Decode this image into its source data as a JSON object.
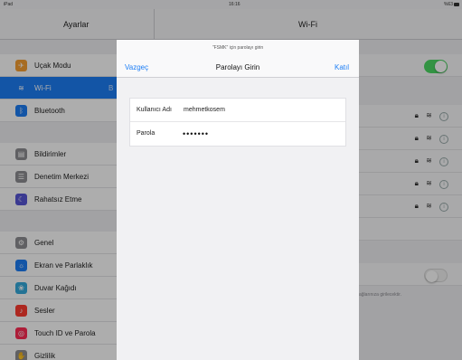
{
  "status_bar": {
    "device": "iPad",
    "time": "16:16",
    "battery": "%63"
  },
  "left_nav": {
    "title": "Ayarlar"
  },
  "right_nav": {
    "title": "Wi-Fi"
  },
  "sidebar": {
    "items": [
      {
        "label": "Uçak Modu",
        "icon": "airplane-icon",
        "color": "#f7a033"
      },
      {
        "label": "Wi-Fi",
        "sub": "B",
        "icon": "wifi-icon",
        "color": "#1d7ef5",
        "active": true
      },
      {
        "label": "Bluetooth",
        "icon": "bluetooth-icon",
        "color": "#1d7ef5"
      },
      {
        "label": "Bildirimler",
        "icon": "notifications-icon",
        "color": "#8e8e93"
      },
      {
        "label": "Denetim Merkezi",
        "icon": "control-center-icon",
        "color": "#8e8e93"
      },
      {
        "label": "Rahatsız Etme",
        "icon": "moon-icon",
        "color": "#5856d6"
      },
      {
        "label": "Genel",
        "icon": "gear-icon",
        "color": "#8e8e93"
      },
      {
        "label": "Ekran ve Parlaklık",
        "icon": "brightness-icon",
        "color": "#1d7ef5"
      },
      {
        "label": "Duvar Kağıdı",
        "icon": "wallpaper-icon",
        "color": "#34aadc"
      },
      {
        "label": "Sesler",
        "icon": "speaker-icon",
        "color": "#ff3b30"
      },
      {
        "label": "Touch ID ve Parola",
        "icon": "fingerprint-icon",
        "color": "#ff2d55"
      },
      {
        "label": "Gizlilik",
        "icon": "hand-icon",
        "color": "#8e8e93"
      }
    ]
  },
  "wifi_detail": {
    "toggle_on": true,
    "ask_toggle_on": false,
    "footnote": "ağlarınıza girilecektir."
  },
  "modal": {
    "prompt": "\"FSMK\" için parolayı girin",
    "cancel": "Vazgeç",
    "title": "Parolayı Girin",
    "join": "Katıl",
    "username_label": "Kullanıcı Adı",
    "username_value": "mehmetkosem",
    "password_label": "Parola",
    "password_value": "•••••••"
  },
  "colors": {
    "accent": "#1d7ef5",
    "toggle_on": "#4cd964"
  }
}
